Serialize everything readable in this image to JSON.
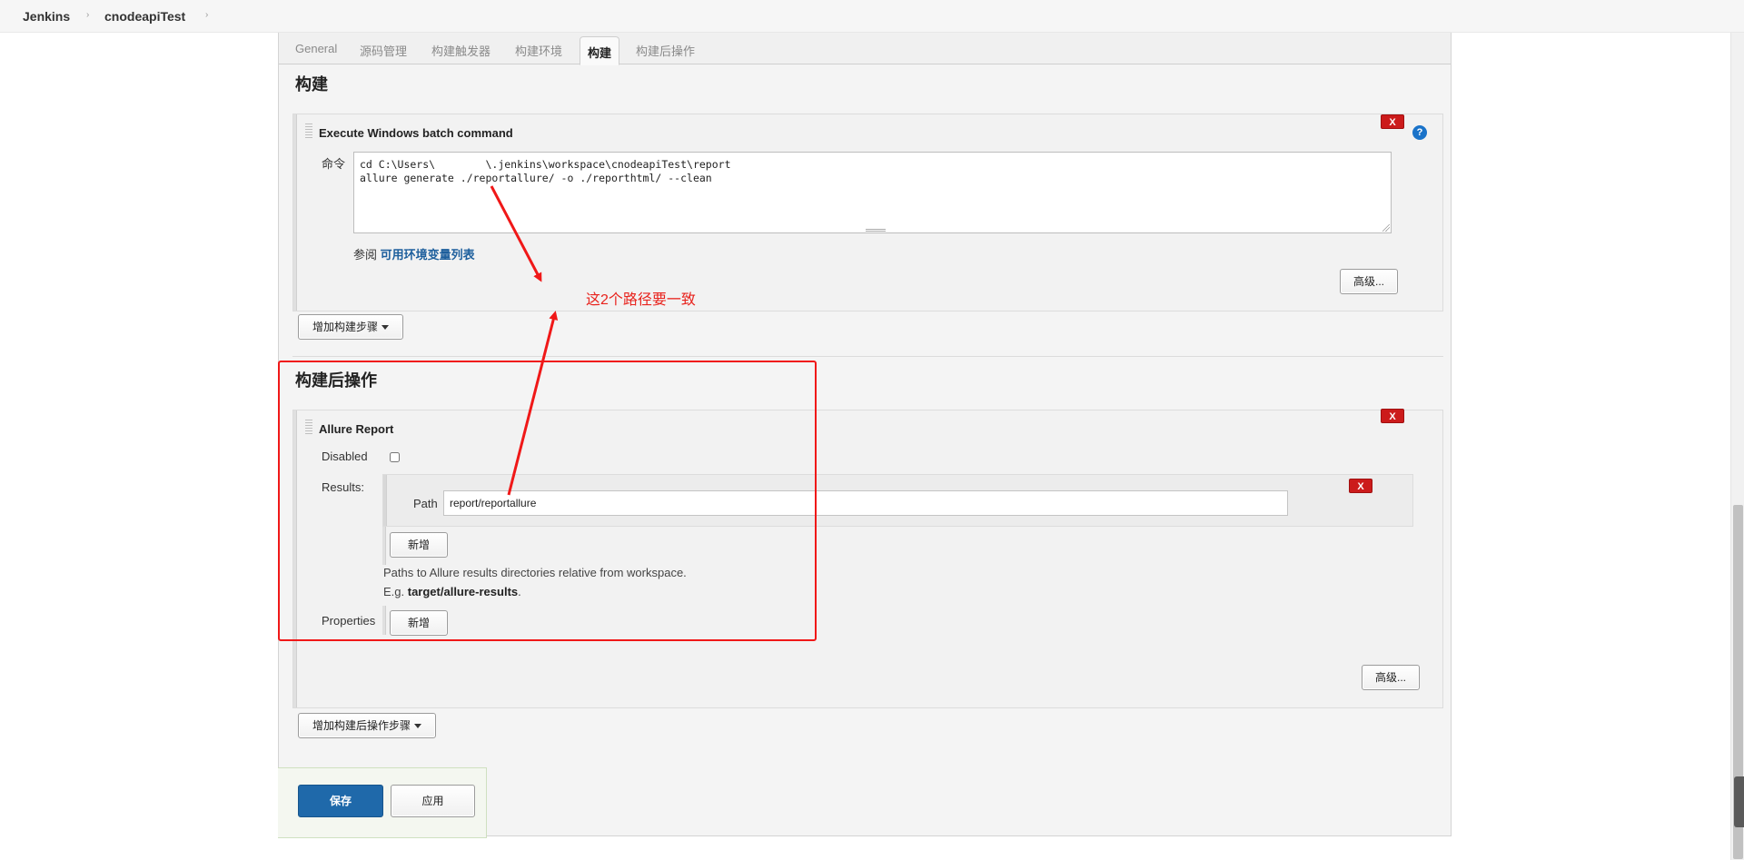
{
  "breadcrumb": {
    "items": [
      "Jenkins",
      "cnodeapiTest"
    ],
    "separator": "›"
  },
  "tabs": [
    {
      "label": "General",
      "active": false
    },
    {
      "label": "源码管理",
      "active": false
    },
    {
      "label": "构建触发器",
      "active": false
    },
    {
      "label": "构建环境",
      "active": false
    },
    {
      "label": "构建",
      "active": true
    },
    {
      "label": "构建后操作",
      "active": false
    }
  ],
  "build": {
    "section_title": "构建",
    "step": {
      "title": "Execute Windows batch command",
      "delete_label": "X",
      "help_label": "?",
      "command_label": "命令",
      "command_value": "cd C:\\Users\\        \\.jenkins\\workspace\\cnodeapiTest\\report\nallure generate ./reportallure/ -o ./reporthtml/ --clean",
      "env_ref_prefix": "参阅",
      "env_ref_link": "可用环境变量列表",
      "advanced_button": "高级..."
    },
    "add_step_button": "增加构建步骤"
  },
  "post_build": {
    "section_title": "构建后操作",
    "allure": {
      "title": "Allure Report",
      "delete_label": "X",
      "disabled_label": "Disabled",
      "disabled_checked": false,
      "results_label": "Results:",
      "path_label": "Path",
      "path_value": "report/reportallure",
      "path_delete_label": "X",
      "add_result_button": "新增",
      "hint_line1": "Paths to Allure results directories relative from workspace.",
      "hint_prefix": "E.g. ",
      "hint_example": "target/allure-results",
      "hint_suffix": ".",
      "properties_label": "Properties",
      "add_property_button": "新增",
      "advanced_button": "高级..."
    },
    "add_step_button": "增加构建后操作步骤"
  },
  "actions": {
    "save_button": "保存",
    "apply_button": "应用"
  },
  "annotation": {
    "text": "这2个路径要一致",
    "color": "#e8221c"
  },
  "colors": {
    "primary_button": "#1f69aa",
    "delete_button": "#cc1b1b",
    "link": "#1c5e9c"
  }
}
